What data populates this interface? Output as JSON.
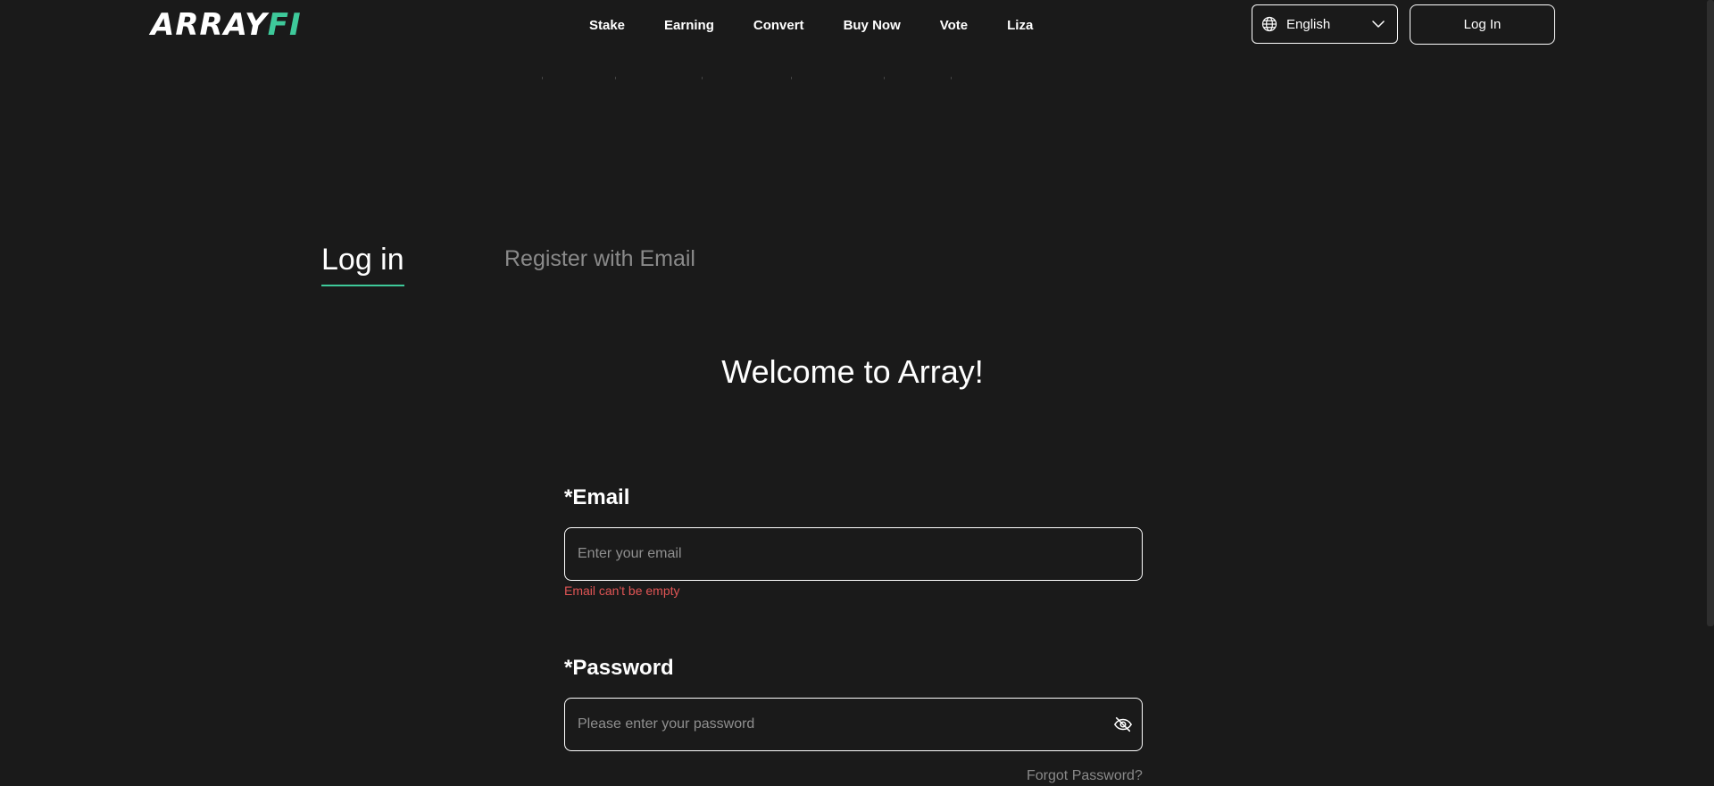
{
  "brand": {
    "logo_part1": "ARRAY",
    "logo_part2": "FI",
    "accent_color": "#3ec99a",
    "error_color": "#e05555"
  },
  "nav": {
    "items": [
      {
        "label": "Stake"
      },
      {
        "label": "Earning"
      },
      {
        "label": "Convert"
      },
      {
        "label": "Buy Now"
      },
      {
        "label": "Vote"
      },
      {
        "label": "Liza"
      }
    ]
  },
  "header": {
    "language": {
      "selected": "English",
      "icon": "globe-icon"
    },
    "login_label": "Log In"
  },
  "tabs": {
    "login": "Log in",
    "register": "Register with Email",
    "active": "login"
  },
  "main": {
    "welcome": "Welcome to Array!",
    "email": {
      "label": "*Email",
      "placeholder": "Enter your email",
      "value": "",
      "error": "Email can't be empty"
    },
    "password": {
      "label": "*Password",
      "placeholder": "Please enter your password",
      "value": "",
      "toggle_icon": "eye-off-icon"
    },
    "forgot_label": "Forgot Password?"
  }
}
